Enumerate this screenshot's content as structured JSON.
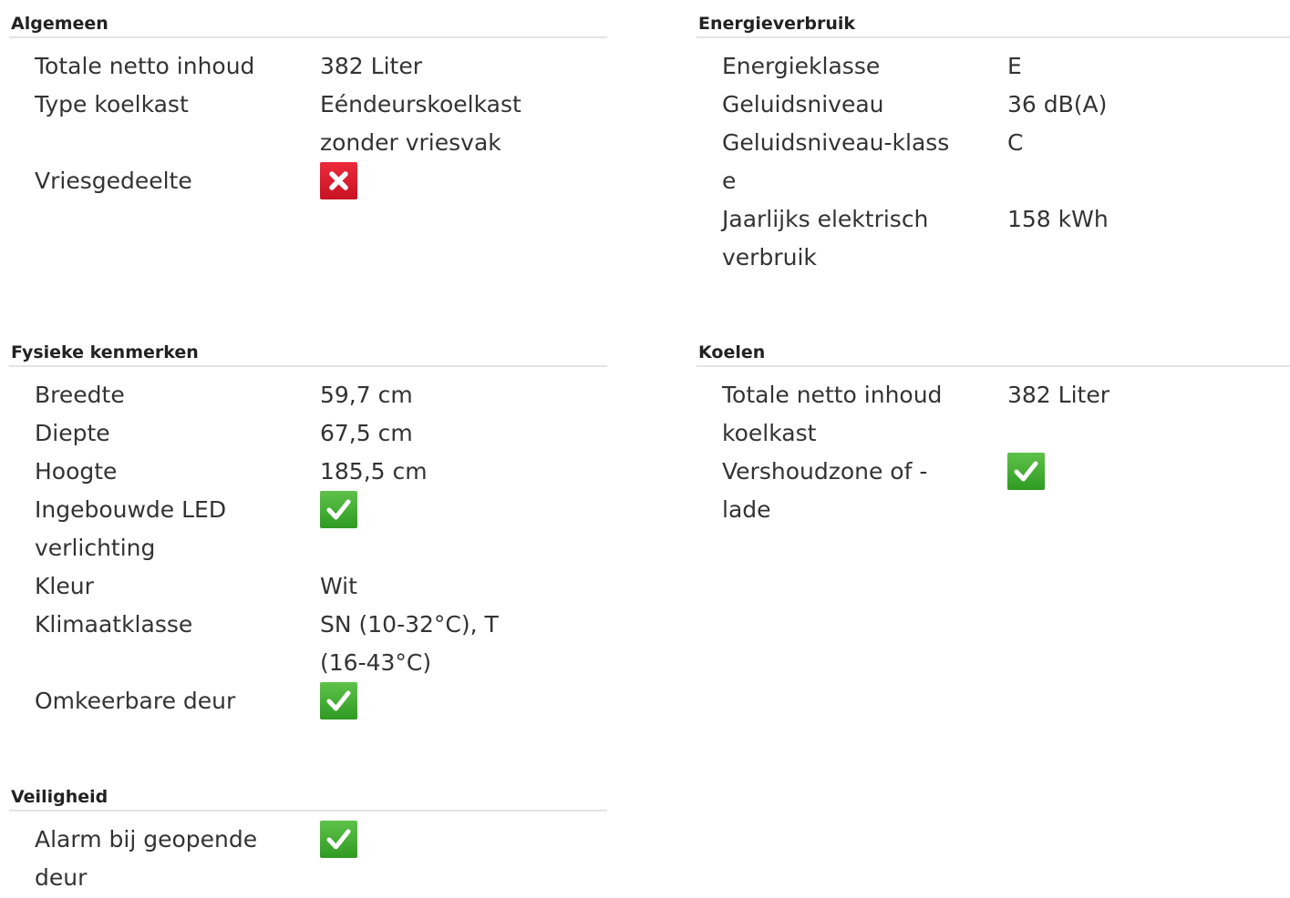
{
  "colors": {
    "yes": "#3aa82c",
    "no": "#d61a2c",
    "divider": "#e4e4e4"
  },
  "sections": {
    "algemeen": {
      "title": "Algemeen",
      "rows": [
        {
          "label": "Totale netto inhoud",
          "value": "382 Liter"
        },
        {
          "label": "Type koelkast",
          "value": "Eéndeurskoelkast zonder vriesvak"
        },
        {
          "label": "Vriesgedeelte",
          "icon": "cross-icon"
        }
      ]
    },
    "energie": {
      "title": "Energieverbruik",
      "rows": [
        {
          "label": "Energieklasse",
          "value": "E"
        },
        {
          "label": "Geluidsniveau",
          "value": "36 dB(A)"
        },
        {
          "label": "Geluidsniveau-klasse",
          "value": "C"
        },
        {
          "label": "Jaarlijks elektrisch verbruik",
          "value": "158 kWh"
        }
      ]
    },
    "fysiek": {
      "title": "Fysieke kenmerken",
      "rows": [
        {
          "label": "Breedte",
          "value": "59,7 cm"
        },
        {
          "label": "Diepte",
          "value": "67,5 cm"
        },
        {
          "label": "Hoogte",
          "value": "185,5 cm"
        },
        {
          "label": "Ingebouwde LED verlichting",
          "icon": "check-icon"
        },
        {
          "label": "Kleur",
          "value": "Wit"
        },
        {
          "label": "Klimaatklasse",
          "value": "SN (10-32°C), T (16-43°C)"
        },
        {
          "label": "Omkeerbare deur",
          "icon": "check-icon"
        }
      ]
    },
    "koelen": {
      "title": "Koelen",
      "rows": [
        {
          "label": "Totale netto inhoud koelkast",
          "value": "382 Liter"
        },
        {
          "label": "Vershoudzone of -lade",
          "icon": "check-icon"
        }
      ]
    },
    "veiligheid": {
      "title": "Veiligheid",
      "rows": [
        {
          "label": "Alarm bij geopende deur",
          "icon": "check-icon"
        }
      ]
    }
  }
}
